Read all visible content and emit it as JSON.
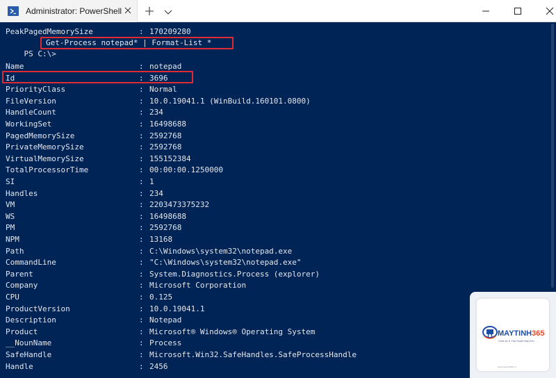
{
  "window": {
    "tab_title": "Administrator: PowerShell"
  },
  "terminal": {
    "first_line": {
      "name": "PeakPagedMemorySize",
      "value": "170209280"
    },
    "prompt": "PS C:\\>",
    "command": "Get-Process notepad* | Format-List *",
    "separator": ":",
    "rows": [
      {
        "name": "Name",
        "value": "notepad"
      },
      {
        "name": "Id",
        "value": "3696"
      },
      {
        "name": "PriorityClass",
        "value": "Normal"
      },
      {
        "name": "FileVersion",
        "value": "10.0.19041.1 (WinBuild.160101.0800)"
      },
      {
        "name": "HandleCount",
        "value": "234"
      },
      {
        "name": "WorkingSet",
        "value": "16498688"
      },
      {
        "name": "PagedMemorySize",
        "value": "2592768"
      },
      {
        "name": "PrivateMemorySize",
        "value": "2592768"
      },
      {
        "name": "VirtualMemorySize",
        "value": "155152384"
      },
      {
        "name": "TotalProcessorTime",
        "value": "00:00:00.1250000"
      },
      {
        "name": "SI",
        "value": "1"
      },
      {
        "name": "Handles",
        "value": "234"
      },
      {
        "name": "VM",
        "value": "2203473375232"
      },
      {
        "name": "WS",
        "value": "16498688"
      },
      {
        "name": "PM",
        "value": "2592768"
      },
      {
        "name": "NPM",
        "value": "13168"
      },
      {
        "name": "Path",
        "value": "C:\\Windows\\system32\\notepad.exe"
      },
      {
        "name": "CommandLine",
        "value": "\"C:\\Windows\\system32\\notepad.exe\""
      },
      {
        "name": "Parent",
        "value": "System.Diagnostics.Process (explorer)"
      },
      {
        "name": "Company",
        "value": "Microsoft Corporation"
      },
      {
        "name": "CPU",
        "value": "0.125"
      },
      {
        "name": "ProductVersion",
        "value": "10.0.19041.1"
      },
      {
        "name": "Description",
        "value": "Notepad"
      },
      {
        "name": "Product",
        "value": "Microsoft® Windows® Operating System"
      },
      {
        "name": "__NounName",
        "value": "Process"
      },
      {
        "name": "SafeHandle",
        "value": "Microsoft.Win32.SafeHandles.SafeProcessHandle"
      },
      {
        "name": "Handle",
        "value": "2456"
      }
    ]
  },
  "watermark": {
    "brand_main": "MAYTINH",
    "brand_num": "365",
    "tagline": "Chia sẻ & Thủ thuật Máy tính",
    "url": "www.maytinh365.vn"
  },
  "colors": {
    "background": "#012456",
    "text": "#e4e6ec",
    "highlight": "#e02b33"
  }
}
